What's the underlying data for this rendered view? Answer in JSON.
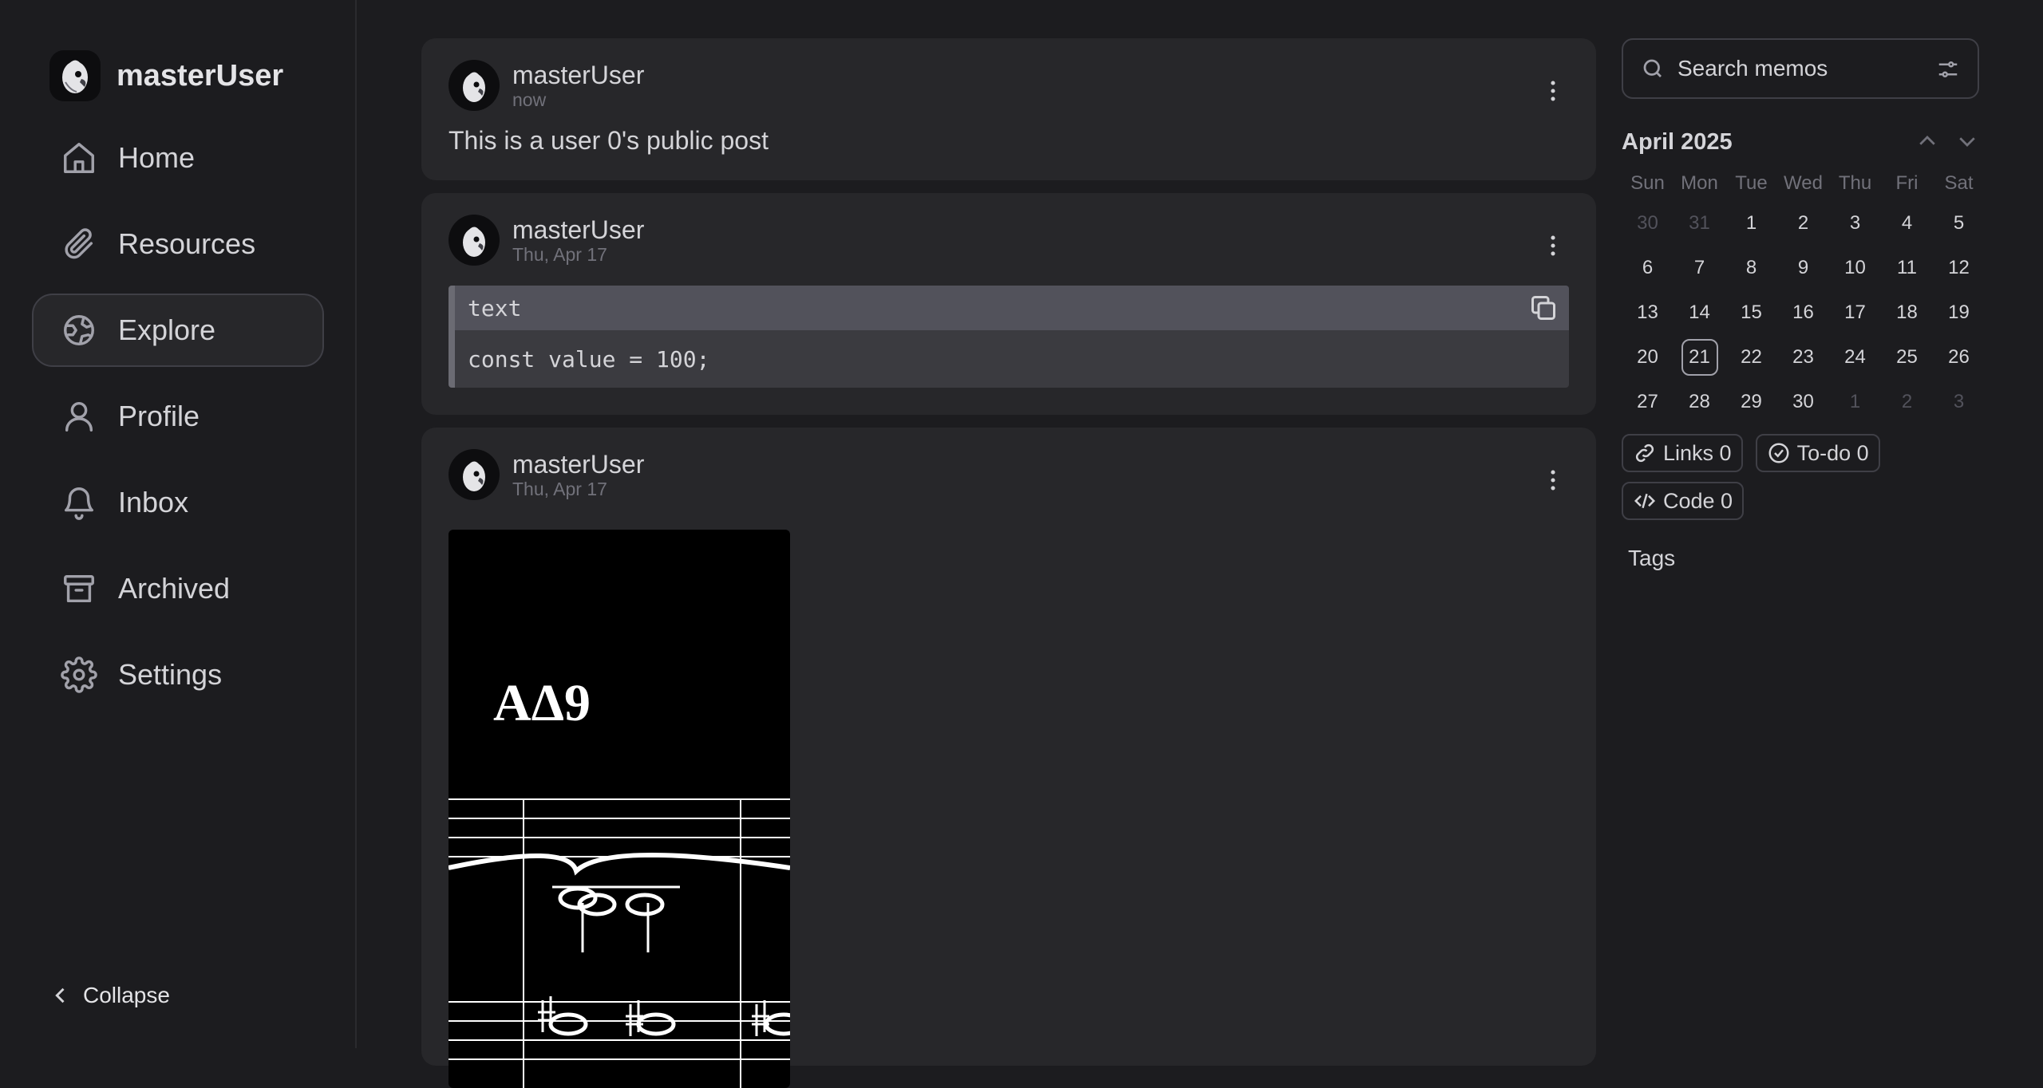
{
  "brand": {
    "name": "masterUser",
    "avatar_icon": "parrot-avatar-icon"
  },
  "nav": {
    "items": [
      {
        "label": "Home",
        "icon": "home-icon",
        "active": false
      },
      {
        "label": "Resources",
        "icon": "paperclip-icon",
        "active": false
      },
      {
        "label": "Explore",
        "icon": "globe-icon",
        "active": true
      },
      {
        "label": "Profile",
        "icon": "user-icon",
        "active": false
      },
      {
        "label": "Inbox",
        "icon": "bell-icon",
        "active": false
      },
      {
        "label": "Archived",
        "icon": "archive-icon",
        "active": false
      },
      {
        "label": "Settings",
        "icon": "gear-icon",
        "active": false
      }
    ],
    "collapse_label": "Collapse"
  },
  "memos": [
    {
      "user": "masterUser",
      "time": "now",
      "text": "This is a user 0's public post"
    },
    {
      "user": "masterUser",
      "time": "Thu, Apr 17",
      "code_lang": "text",
      "code": "const value = 100;"
    },
    {
      "user": "masterUser",
      "time": "Thu, Apr 17",
      "image_text": "AΔ9"
    }
  ],
  "search": {
    "placeholder": "Search memos"
  },
  "calendar": {
    "month": "April 2025",
    "weekdays": [
      "Sun",
      "Mon",
      "Tue",
      "Wed",
      "Thu",
      "Fri",
      "Sat"
    ],
    "days": [
      "30",
      "31",
      "1",
      "2",
      "3",
      "4",
      "5",
      "6",
      "7",
      "8",
      "9",
      "10",
      "11",
      "12",
      "13",
      "14",
      "15",
      "16",
      "17",
      "18",
      "19",
      "20",
      "21",
      "22",
      "23",
      "24",
      "25",
      "26",
      "27",
      "28",
      "29",
      "30",
      "1",
      "2",
      "3"
    ],
    "today": "21"
  },
  "stats": [
    {
      "label": "Links 0",
      "icon": "link-icon"
    },
    {
      "label": "To-do 0",
      "icon": "check-circle-icon"
    },
    {
      "label": "Code 0",
      "icon": "code-icon"
    }
  ],
  "tags": {
    "title": "Tags"
  },
  "colors": {
    "background": "#1c1c1f",
    "card": "#27272a",
    "code_header": "#52525b"
  }
}
